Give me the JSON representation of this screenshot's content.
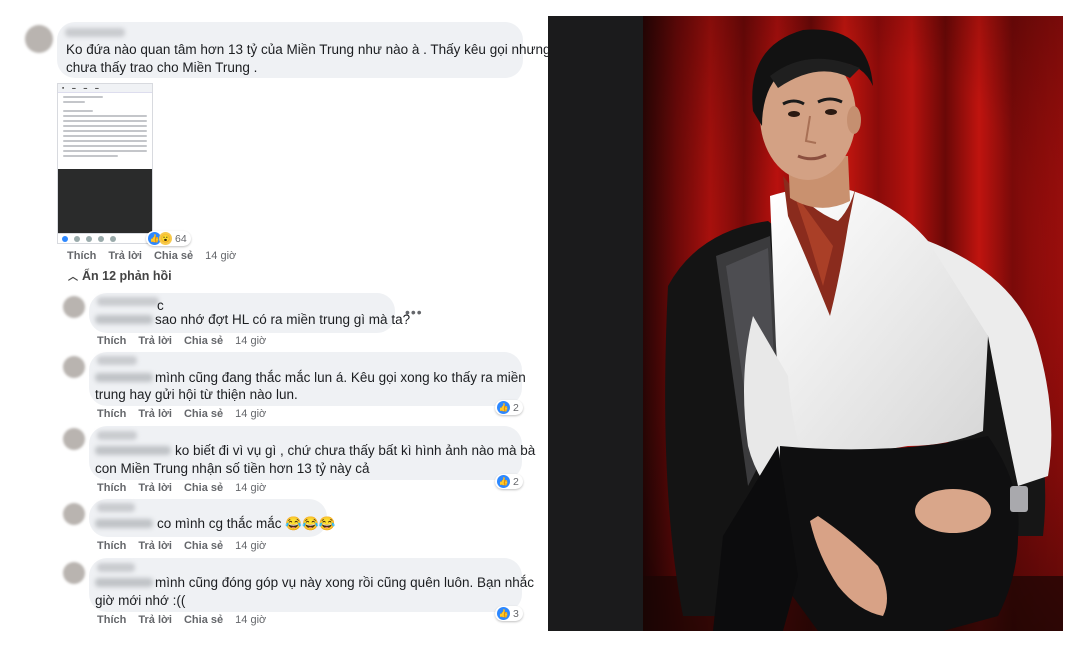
{
  "post_comment": {
    "text_line1": "Ko đứa nào quan tâm hơn 13 tỷ của Miền Trung như nào à . Thấy kêu gọi nhưng",
    "text_line2": "chưa thấy trao cho Miền Trung .",
    "reaction_count": "64",
    "actions": {
      "like": "Thích",
      "reply": "Trả lời",
      "share": "Chia sẻ",
      "time": "14 giờ"
    }
  },
  "hide_replies_label": "Ẩn 12 phản hồi",
  "replies": [
    {
      "text_prefix": "c",
      "text_line1": "sao nhớ đợt HL có ra miền trung gì mà ta?",
      "text_line2": "",
      "reaction_count": "",
      "actions": {
        "like": "Thích",
        "reply": "Trả lời",
        "share": "Chia sẻ",
        "time": "14 giờ"
      }
    },
    {
      "text_line1": "mình cũng đang thắc mắc lun á. Kêu gọi xong ko thấy ra miền",
      "text_line2": "trung hay gửi hội từ thiện nào lun.",
      "reaction_count": "2",
      "actions": {
        "like": "Thích",
        "reply": "Trả lời",
        "share": "Chia sẻ",
        "time": "14 giờ"
      }
    },
    {
      "text_line1": "ko biết đi vì vụ gì , chứ chưa thấy bất kì hình ảnh nào mà bà",
      "text_line2": "con Miền Trung nhận số tiền hơn 13 tỷ này cả",
      "reaction_count": "2",
      "actions": {
        "like": "Thích",
        "reply": "Trả lời",
        "share": "Chia sẻ",
        "time": "14 giờ"
      }
    },
    {
      "text_line1": "co mình cg thắc mắc 😂😂😂",
      "text_line2": "",
      "reaction_count": "",
      "actions": {
        "like": "Thích",
        "reply": "Trả lời",
        "share": "Chia sẻ",
        "time": "14 giờ"
      }
    },
    {
      "text_line1": "mình cũng đóng góp vụ này xong rồi cũng quên luôn. Bạn nhắc",
      "text_line2": "giờ mới nhớ :((",
      "reaction_count": "3",
      "actions": {
        "like": "Thích",
        "reply": "Trả lời",
        "share": "Chia sẻ",
        "time": "14 giờ"
      }
    }
  ],
  "more_options_glyph": "•••",
  "icons": {
    "reaction_like": "like-icon",
    "reaction_haha": "haha-icon",
    "more": "more-options-icon"
  },
  "colors": {
    "bubble": "#eff1f4",
    "meta_text": "#65676b",
    "like_blue": "#2d88ff",
    "curtain_red": "#b2100e"
  }
}
